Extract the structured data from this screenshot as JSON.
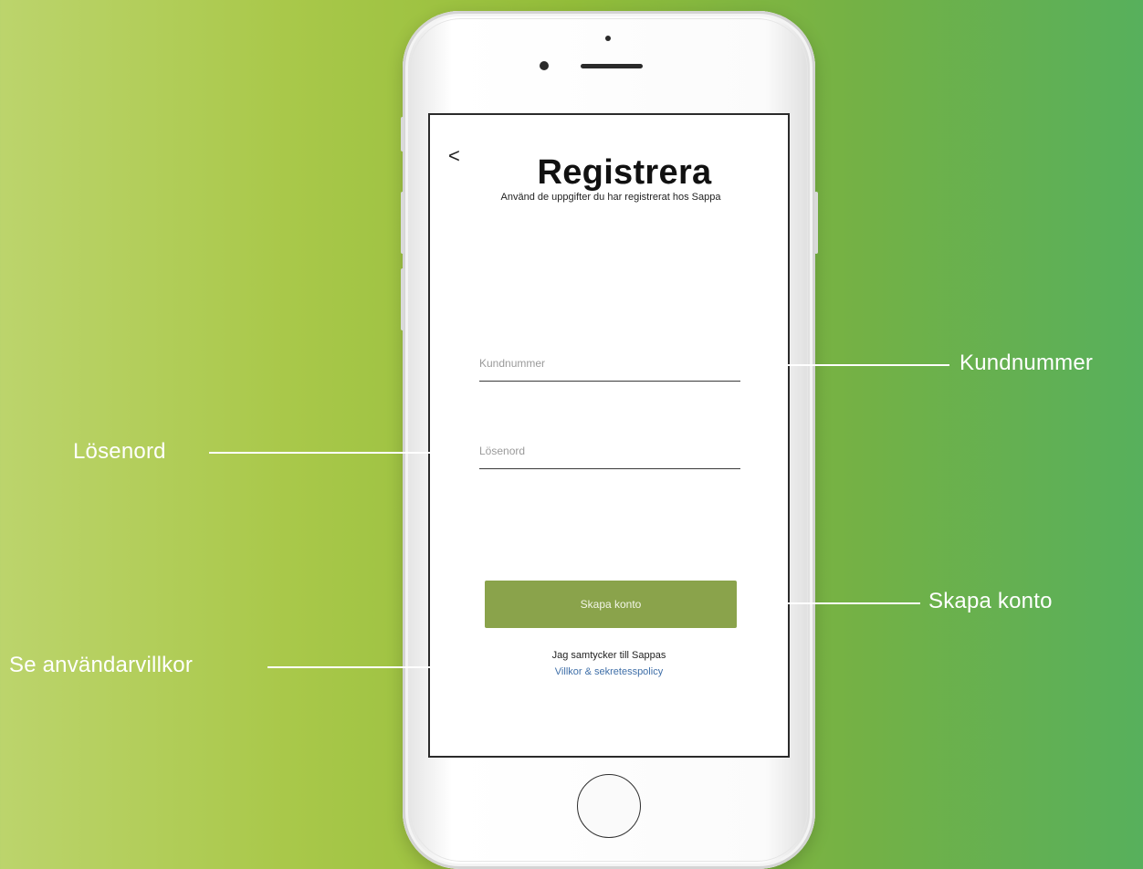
{
  "screen": {
    "back_icon": "chevron-left-icon",
    "back_glyph": "<",
    "title": "Registrera",
    "subtitle": "Använd de uppgifter du har registrerat hos Sappa",
    "customer_number_placeholder": "Kundnummer",
    "password_placeholder": "Lösenord",
    "create_account_label": "Skapa konto",
    "consent_text": "Jag samtycker till Sappas",
    "terms_link": "Villkor & sekretesspolicy"
  },
  "callouts": {
    "customer_number": "Kundnummer",
    "password": "Lösenord",
    "create_account": "Skapa konto",
    "terms": "Se användarvillkor"
  },
  "colors": {
    "background_left": "#bcd46c",
    "background_right": "#57b05c",
    "button": "#8aa34b",
    "link": "#3f6fa8"
  }
}
